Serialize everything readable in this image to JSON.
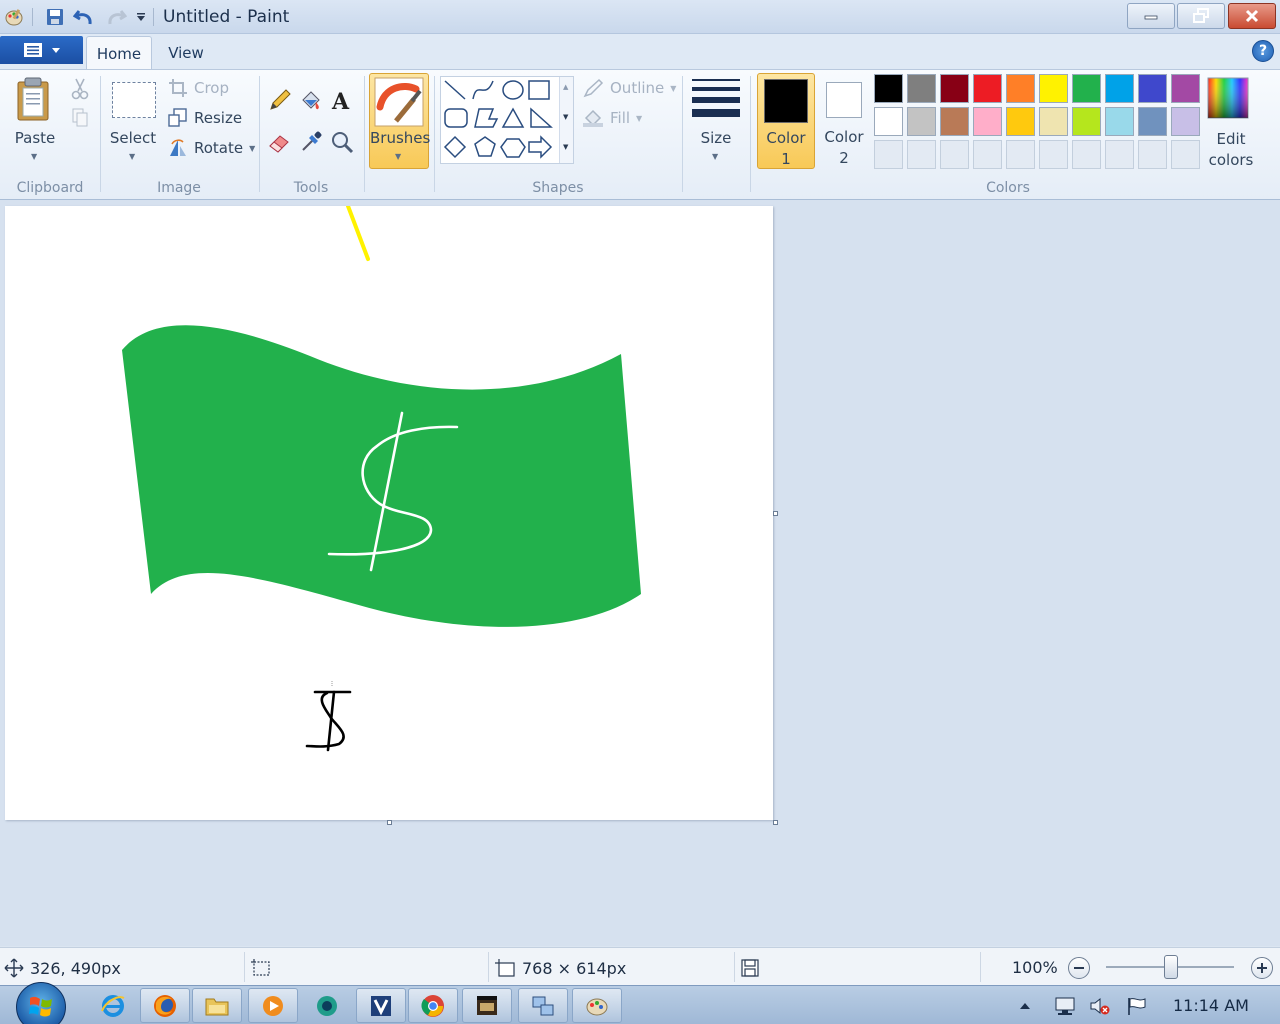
{
  "window": {
    "title": "Untitled - Paint"
  },
  "tabs": [
    {
      "label": "Home"
    },
    {
      "label": "View"
    }
  ],
  "ribbon": {
    "clipboard": {
      "paste_label": "Paste",
      "group_label": "Clipboard"
    },
    "image": {
      "select_label": "Select",
      "crop_label": "Crop",
      "resize_label": "Resize",
      "rotate_label": "Rotate",
      "group_label": "Image"
    },
    "tools": {
      "group_label": "Tools"
    },
    "brushes": {
      "label": "Brushes"
    },
    "shapes": {
      "outline_label": "Outline",
      "fill_label": "Fill",
      "group_label": "Shapes"
    },
    "size": {
      "label": "Size"
    },
    "colors": {
      "color1_label": "Color",
      "color1_num": "1",
      "color1_value": "#000000",
      "color2_label": "Color",
      "color2_num": "2",
      "color2_value": "#ffffff",
      "palette_row1": [
        "#000000",
        "#7f7f7f",
        "#880015",
        "#ed1c24",
        "#ff7f27",
        "#fff200",
        "#22b14c",
        "#00a2e8",
        "#3f48cc",
        "#a349a4"
      ],
      "palette_row2": [
        "#ffffff",
        "#c3c3c3",
        "#b97a57",
        "#ffaec9",
        "#ffc90e",
        "#efe4b0",
        "#b5e61d",
        "#99d9ea",
        "#7092be",
        "#c8bfe7"
      ],
      "edit_label_line1": "Edit",
      "edit_label_line2": "colors",
      "group_label": "Colors"
    }
  },
  "canvas": {
    "background": "#ffffff",
    "flag_color": "#22b14c"
  },
  "status": {
    "cursor_pos": "326, 490px",
    "canvas_size": "768 × 614px",
    "zoom": "100%"
  },
  "taskbar": {
    "clock": "11:14 AM"
  }
}
